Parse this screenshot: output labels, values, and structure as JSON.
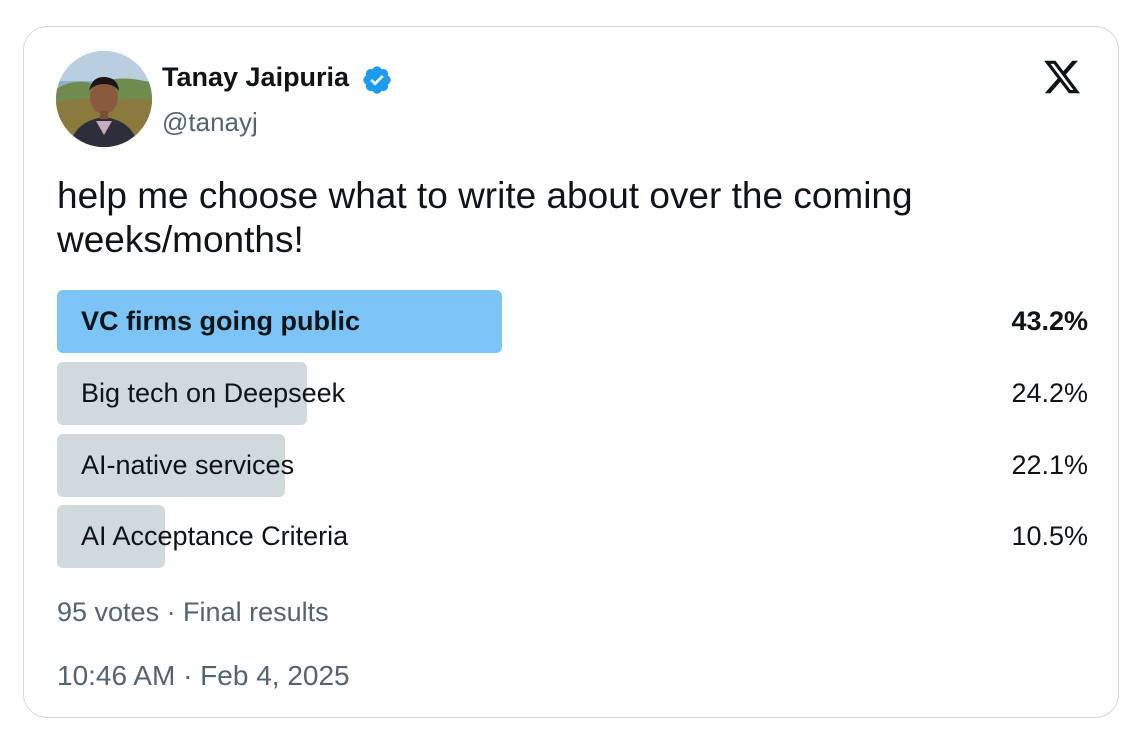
{
  "author": {
    "name": "Tanay Jaipuria",
    "handle": "@tanayj",
    "verified_icon": "verified-badge-icon",
    "avatar": "avatar-photo"
  },
  "brand": {
    "logo_icon": "x-logo-icon"
  },
  "tweet": {
    "text": "help me choose what to write about over the coming weeks/months!"
  },
  "poll": {
    "options": [
      {
        "label": "VC firms going public",
        "percent_text": "43.2%",
        "percent": 43.2,
        "winner": true
      },
      {
        "label": "Big tech on Deepseek",
        "percent_text": "24.2%",
        "percent": 24.2,
        "winner": false
      },
      {
        "label": "AI-native services",
        "percent_text": "22.1%",
        "percent": 22.1,
        "winner": false
      },
      {
        "label": "AI Acceptance Criteria",
        "percent_text": "10.5%",
        "percent": 10.5,
        "winner": false
      }
    ],
    "summary": "95 votes · Final results"
  },
  "meta": {
    "timestamp": "10:46 AM · Feb 4, 2025"
  },
  "colors": {
    "winner_bar": "#7cc4f5",
    "bar": "#cfd9de",
    "secondary_text": "#536471",
    "verified": "#1d9bf0",
    "border": "#cfd9de"
  }
}
